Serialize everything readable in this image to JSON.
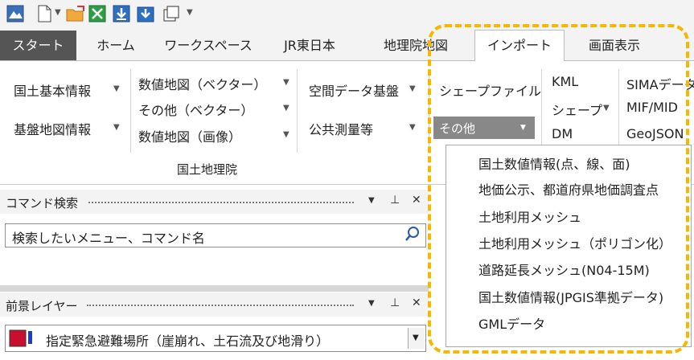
{
  "tabs": [
    "スタート",
    "ホーム",
    "ワークスペース",
    "JR東日本",
    "地理院地図",
    "インポート",
    "画面表示"
  ],
  "ribbon": {
    "kihon": "国土基本情報",
    "kiban": "基盤地図情報",
    "vector": "数値地図（ベクター）",
    "other_vector": "その他（ベクター）",
    "image": "数値地図（画像）",
    "spatial": "空間データ基盤",
    "survey": "公共測量等",
    "group_label": "国土地理院",
    "shape_file": "シェープファイル",
    "other": "その他",
    "kml": "KML",
    "shape": "シェープ",
    "dm": "DM",
    "sima": "SIMAデータ",
    "mif": "MIF/MID",
    "geojson": "GeoJSON"
  },
  "command_panel": {
    "title": "コマンド検索",
    "search_value": "検索したいメニュー、コマンド名"
  },
  "layer_panel": {
    "title": "前景レイヤー",
    "selected_layer": "指定緊急避難場所（崖崩れ、土石流及び地滑り）"
  },
  "menu_items": [
    "国土数値情報(点、線、面)",
    "地価公示、都道府県地価調査点",
    "土地利用メッシュ",
    "土地利用メッシュ（ポリゴン化）",
    "道路延長メッシュ(N04-15M)",
    "国土数値情報(JPGIS準拠データ)",
    "GMLデータ"
  ],
  "colors": {
    "accent": "#f5b800",
    "start_tab": "#555555",
    "hover": "#888888"
  }
}
